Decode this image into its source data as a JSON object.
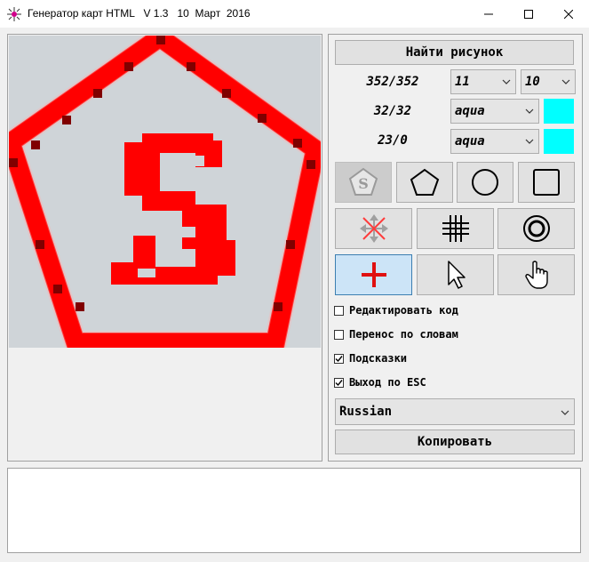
{
  "window": {
    "title": "Генератор карт HTML   V 1.3   10  Март  2016"
  },
  "colors": {
    "fill": "#ff0000",
    "swatch1": "#00ffff",
    "swatch2": "#00ffff",
    "canvas_bg": "#cfd4d8"
  },
  "controls": {
    "find_image_button": "Найти рисунок",
    "size_label": "352/352",
    "cell_label": "32/32",
    "pos_label": "23/0",
    "combo_grid_x": "11",
    "combo_grid_y": "10",
    "combo_color1": "aqua",
    "combo_color2": "aqua",
    "tools": [
      "logo-s",
      "pentagon",
      "circle",
      "square",
      "move-cross",
      "grid",
      "target",
      "plus",
      "arrow-cursor",
      "hand-cursor"
    ],
    "active_tool": "plus",
    "checkboxes": [
      {
        "label": "Редактировать код",
        "checked": false
      },
      {
        "label": "Перенос по словам",
        "checked": false
      },
      {
        "label": "Подсказки",
        "checked": true
      },
      {
        "label": "Выход по ESC",
        "checked": true
      }
    ],
    "language": "Russian",
    "copy_button": "Копировать"
  },
  "code_output": ""
}
